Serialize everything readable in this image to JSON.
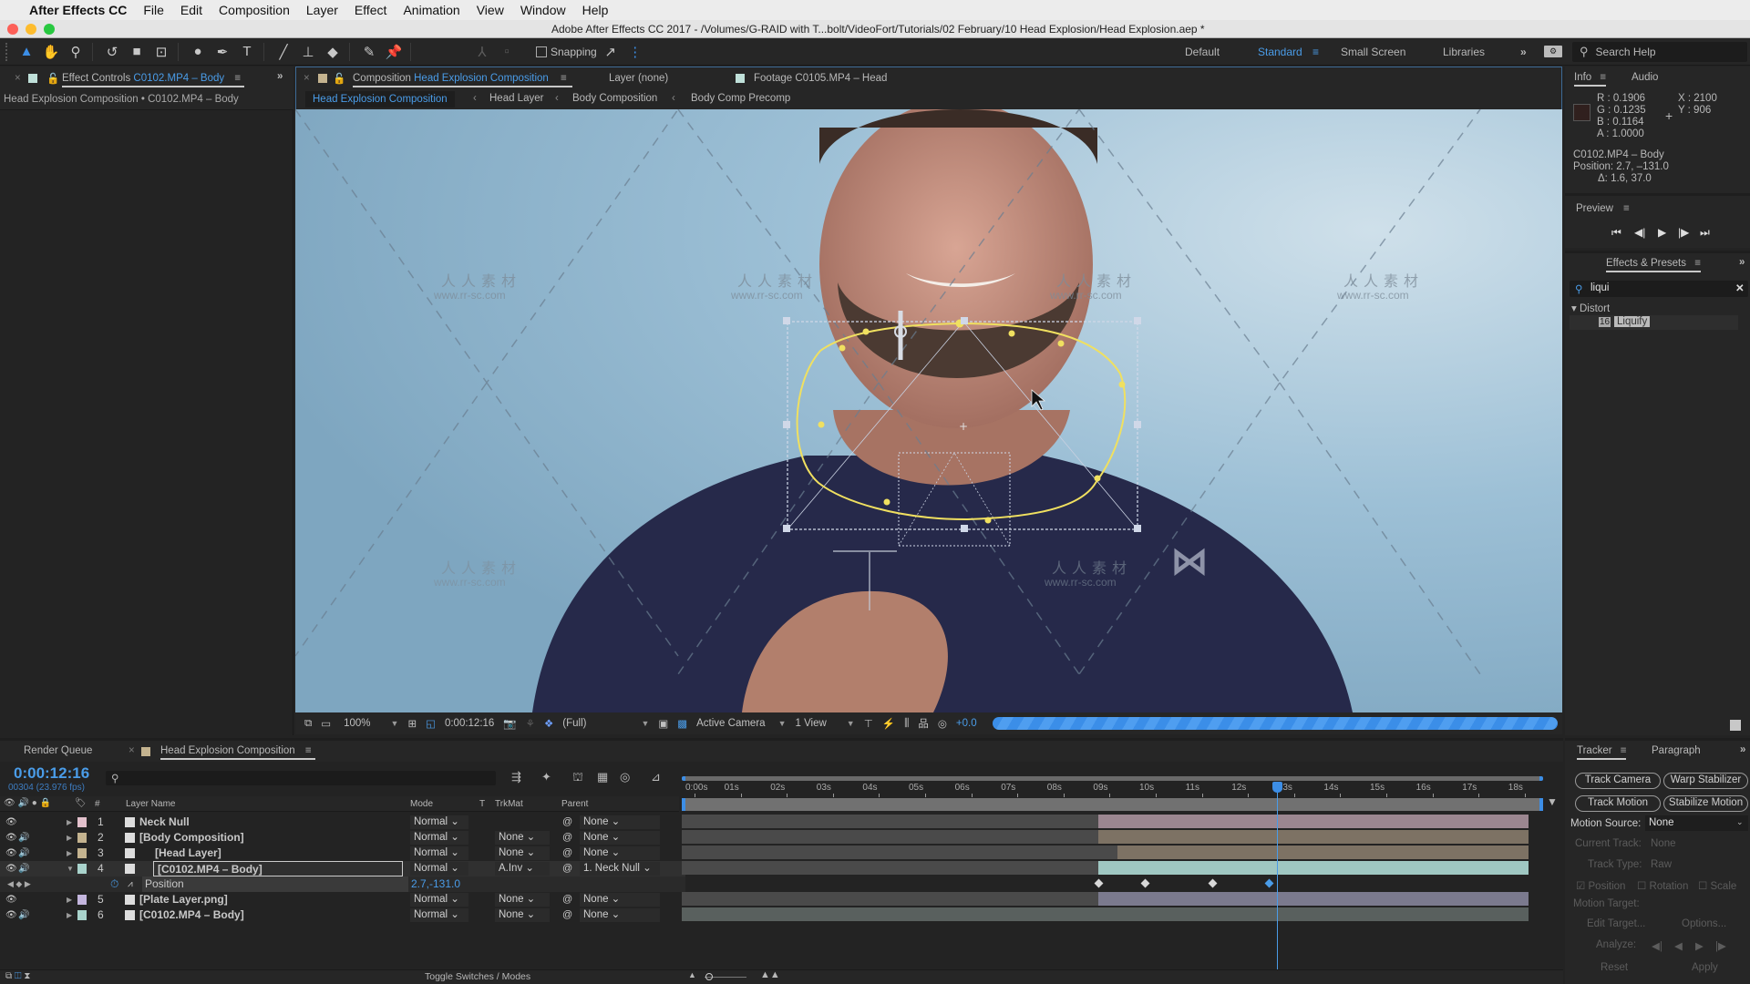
{
  "menubar": {
    "app_name": "After Effects CC",
    "items": [
      "File",
      "Edit",
      "Composition",
      "Layer",
      "Effect",
      "Animation",
      "View",
      "Window",
      "Help"
    ]
  },
  "window": {
    "title": "Adobe After Effects CC 2017 - /Volumes/G-RAID with T...bolt/VideoFort/Tutorials/02 February/10 Head Explosion/Head Explosion.aep *"
  },
  "toolbar": {
    "tools": [
      "selection-tool",
      "hand-tool",
      "zoom-tool",
      "rotation-tool",
      "camera-tool",
      "pan-behind-tool",
      "ellipse-tool",
      "pen-tool",
      "type-tool",
      "brush-tool",
      "clone-stamp-tool",
      "eraser-tool",
      "roto-brush-tool",
      "puppet-pin-tool"
    ],
    "snapping_label": "Snapping",
    "snapping_checked": false,
    "workspaces": [
      "Default",
      "Standard",
      "Small Screen",
      "Libraries"
    ],
    "active_workspace": "Standard",
    "search_help_placeholder": "Search Help"
  },
  "effect_controls": {
    "tab_prefix": "Effect Controls",
    "tab_layer": "C0102.MP4 – Body",
    "subtitle": "Head Explosion Composition • C0102.MP4 – Body"
  },
  "viewer_tabs": {
    "composition_prefix": "Composition",
    "composition_name": "Head Explosion Composition",
    "layer_tab": "Layer (none)",
    "footage_tab": "Footage C0105.MP4 – Head",
    "breadcrumbs": [
      "Head Explosion Composition",
      "Head Layer",
      "Body Composition",
      "Body Comp Precomp"
    ]
  },
  "viewer_bar": {
    "zoom": "100%",
    "timecode": "0:00:12:16",
    "resolution": "(Full)",
    "camera": "Active Camera",
    "views": "1 View",
    "exposure": "+0.0"
  },
  "watermark": {
    "cn": "人人素材",
    "url": "www.rr-sc.com"
  },
  "info": {
    "tabs": [
      "Info",
      "Audio"
    ],
    "swatch_color": "#30201e",
    "r": "R : 0.1906",
    "g": "G : 0.1235",
    "b": "B : 0.1164",
    "a": "A : 1.0000",
    "x": "X : 2100",
    "y": "Y : 906",
    "layer": "C0102.MP4 – Body",
    "position": "Position: 2.7, –131.0",
    "delta": "Δ: 1.6, 37.0"
  },
  "preview": {
    "title": "Preview"
  },
  "effects_presets": {
    "title": "Effects & Presets",
    "search_value": "liqui",
    "category": "Distort",
    "result": "Liquify"
  },
  "timeline": {
    "render_queue_tab": "Render Queue",
    "comp_tab": "Head Explosion Composition",
    "timecode": "0:00:12:16",
    "frame_info": "00304 (23.976 fps)",
    "columns": {
      "label": "#",
      "layer_name": "Layer Name",
      "mode": "Mode",
      "t": "T",
      "trkmat": "TrkMat",
      "parent": "Parent"
    },
    "ruler": [
      "0:00s",
      "01s",
      "02s",
      "03s",
      "04s",
      "05s",
      "06s",
      "07s",
      "08s",
      "09s",
      "10s",
      "11s",
      "12s",
      "13s",
      "14s",
      "15s",
      "16s",
      "17s",
      "18s"
    ],
    "current_time_seconds": 12.67,
    "duration_seconds": 18.6,
    "layers": [
      {
        "num": "1",
        "name": "Neck Null",
        "mode": "Normal",
        "trkmat": "",
        "parent": "None",
        "label_color": "#e3c1cc",
        "audio": false,
        "bar_color": "#9b8690",
        "bar_start": 9.0
      },
      {
        "num": "2",
        "name": "[Body Composition]",
        "mode": "Normal",
        "trkmat": "None",
        "parent": "None",
        "label_color": "#c4b38f",
        "audio": true,
        "bar_color": "#7d7264",
        "bar_start": 9.0
      },
      {
        "num": "3",
        "name": "[Head Layer]",
        "mode": "Normal",
        "trkmat": "None",
        "parent": "None",
        "label_color": "#c4b38f",
        "audio": true,
        "bar_color": "#7d7264",
        "bar_start": 9.4
      },
      {
        "num": "4",
        "name": "[C0102.MP4 – Body]",
        "mode": "Normal",
        "trkmat": "A.Inv",
        "parent": "1. Neck Null",
        "label_color": "#a9d3cc",
        "audio": true,
        "bar_color": "#9fc7c2",
        "bar_start": 9.0,
        "selected": true
      },
      {
        "num": "5",
        "name": "[Plate Layer.png]",
        "mode": "Normal",
        "trkmat": "None",
        "parent": "None",
        "label_color": "#c4b6de",
        "audio": false,
        "bar_color": "#7b7a8e",
        "bar_start": 9.0
      },
      {
        "num": "6",
        "name": "[C0102.MP4 – Body]",
        "mode": "Normal",
        "trkmat": "None",
        "parent": "None",
        "label_color": "#a9d3cc",
        "audio": true,
        "bar_color": "#59605e",
        "bar_start": 0.0
      }
    ],
    "property": {
      "name": "Position",
      "value": "2.7,-131.0",
      "keyframes_seconds": [
        9.0,
        10.0,
        11.45,
        12.67
      ]
    },
    "toggle_label": "Toggle Switches / Modes"
  },
  "tracker": {
    "tabs": [
      "Tracker",
      "Paragraph"
    ],
    "buttons": [
      "Track Camera",
      "Warp Stabilizer",
      "Track Motion",
      "Stabilize Motion"
    ],
    "motion_source_label": "Motion Source:",
    "motion_source_value": "None",
    "current_track_label": "Current Track:",
    "current_track_value": "None",
    "track_type_label": "Track Type:",
    "track_type_value": "Raw",
    "checks": [
      {
        "label": "Position",
        "checked": true
      },
      {
        "label": "Rotation",
        "checked": false
      },
      {
        "label": "Scale",
        "checked": false
      }
    ],
    "motion_target_label": "Motion Target:",
    "edit_target": "Edit Target...",
    "options": "Options...",
    "analyze_label": "Analyze:",
    "reset": "Reset",
    "apply": "Apply"
  }
}
